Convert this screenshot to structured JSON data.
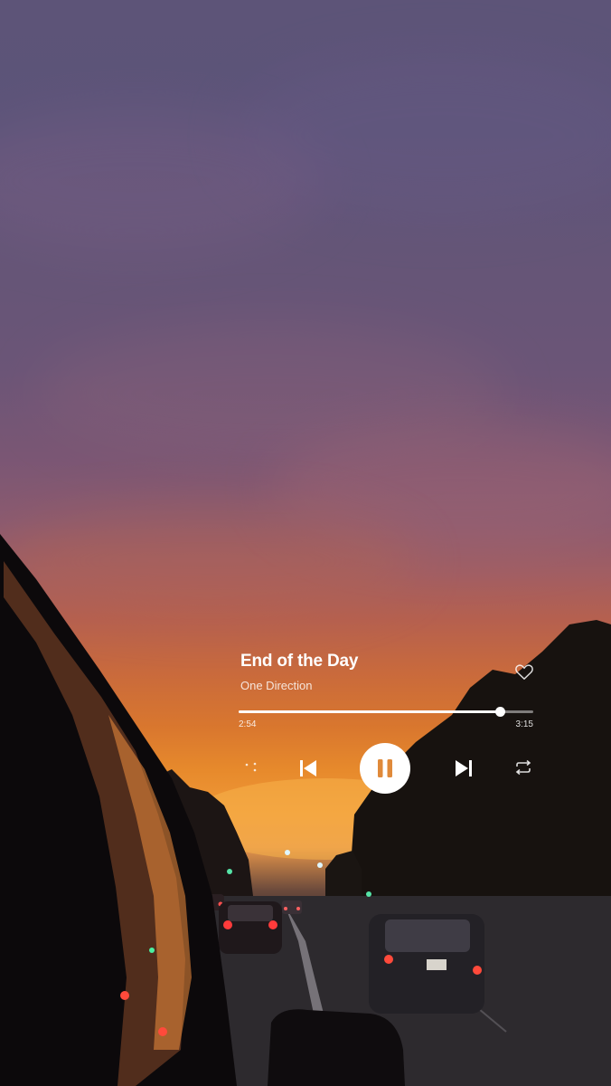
{
  "player": {
    "track_title": "End of the Day",
    "artist": "One Direction",
    "elapsed": "2:54",
    "duration": "3:15",
    "progress_fraction": 0.887,
    "state": "playing",
    "liked": false
  },
  "icons": {
    "like": "heart-outline-icon",
    "shuffle": "shuffle-icon",
    "previous": "skip-previous-icon",
    "play_pause": "pause-icon",
    "next": "skip-next-icon",
    "repeat": "repeat-icon"
  },
  "colors": {
    "foreground": "#ffffff",
    "play_icon": "#e08a3a",
    "track_inactive": "rgba(255,255,255,0.45)"
  }
}
